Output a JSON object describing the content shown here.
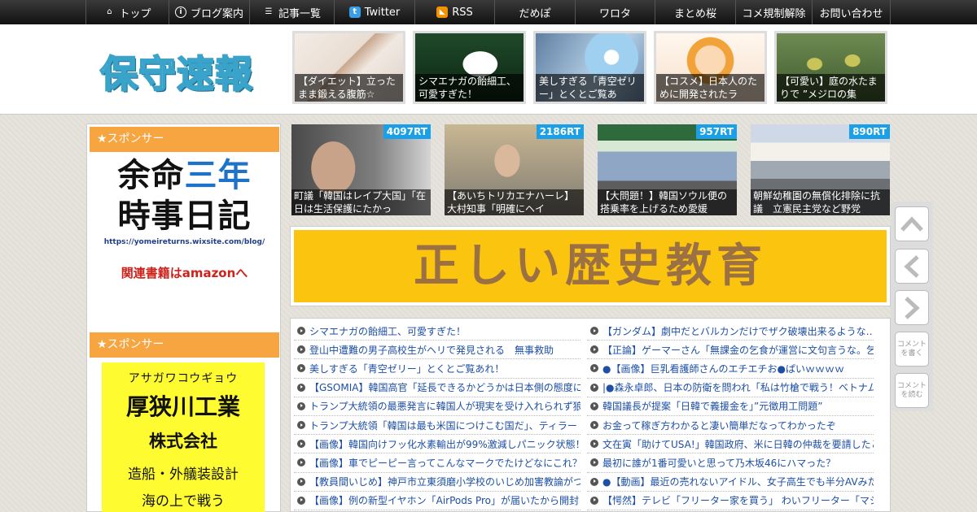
{
  "nav": {
    "items": [
      {
        "label": "トップ",
        "icon": "home-icon"
      },
      {
        "label": "ブログ案内",
        "icon": "info-icon"
      },
      {
        "label": "記事一覧",
        "icon": "list-icon"
      },
      {
        "label": "Twitter",
        "icon": "twitter-icon"
      },
      {
        "label": "RSS",
        "icon": "rss-icon"
      },
      {
        "label": "だめぽ"
      },
      {
        "label": "ワロタ"
      },
      {
        "label": "まとめ桜"
      },
      {
        "label": "コメ規制解除"
      },
      {
        "label": "お問い合わせ"
      }
    ]
  },
  "header": {
    "logo": "保守速報",
    "features": [
      {
        "caption": "【ダイエット】立ったまま鍛える腹筋☆"
      },
      {
        "caption": "シマエナガの飴細工、可愛すぎた！"
      },
      {
        "caption": "美しすぎる「青空ゼリー」とくとご覧あ"
      },
      {
        "caption": "【コスメ】日本人のために開発されたラ"
      },
      {
        "caption": "【可愛い】庭の水たまりで ”メジロの集"
      }
    ]
  },
  "sidebar": {
    "sponsor_label": "★スポンサー",
    "ad1": {
      "line1_a": "余命",
      "line1_b": "三年",
      "line2": "時事日記",
      "url": "https://yomeireturns.wixsite.com/blog/",
      "link": "関連書籍はamazonへ"
    },
    "ad2": {
      "kana": "アサガワコウギョウ",
      "name": "厚狭川工業",
      "corp": "株式会社",
      "desc1": "造船・外艤装設計",
      "desc2": "海の上で戦う"
    }
  },
  "trending": [
    {
      "rt": "4097RT",
      "caption": "町議「韓国はレイプ大国」「在日は生活保護にたかっ"
    },
    {
      "rt": "2186RT",
      "caption": "【あいちトリカエナハーレ】大村知事「明確にヘイ"
    },
    {
      "rt": "957RT",
      "caption": "【大問題！】韓国ソウル便の搭乗率を上げるため愛媛"
    },
    {
      "rt": "890RT",
      "caption": "朝鮮幼稚園の無償化排除に抗議　立憲民主党など野党"
    }
  ],
  "banner": {
    "text": "正しい歴史教育"
  },
  "articles_left": [
    "シマエナガの飴細工、可愛すぎた！",
    "登山中遭難の男子高校生がヘリで発見される　無事救助",
    "美しすぎる「青空ゼリー」とくとご覧あれ！",
    "【GSOMIA】韓国高官「延長できるかどうかは日本側の態度に",
    "トランプ大統領の最悪発言に韓国人が現実を受け入れられず狼",
    "トランプ大統領「韓国は最も米国につけこむ国だ」、ティラー",
    "【画像】韓国向けフッ化水素輸出が99%激減しパニック状態！",
    "【画像】車でピーピー言ってこんなマークでたけどなにこれ？",
    "【教員間いじめ】神戸市立東須磨小学校のいじめ加害教論がつ",
    "【画像】例の新型イヤホン「AirPods Pro」が届いたから開封し"
  ],
  "articles_right": [
    "【ガンダム】劇中だとバルカンだけでザク破壊出来るような…",
    "【正論】ゲーマーさん「無課金の乞食が運営に文句言うな。乞",
    "●【画像】巨乳看護師さんのエチエチお●ぱいｗｗｗｗ",
    "|●森永卓郎、日本の防衛を問われ「私は竹槍で戦う！ベトナム",
    "韓国議長が提案「日韓で義援金を」”元徴用工問題”",
    "お金って稼ぎ方わかると凄い簡単だなってわかったぞ",
    "文在寅「助けてUSA!」韓国政府、米に日韓の仲裁を要請したと",
    "最初に誰が1番可愛いと思って乃木坂46にハマった？",
    "●【動画】最近の売れないアイドル、女子高生でも半分AVみた",
    "【愕然】テレビ「フリーター家を買う」 わいフリーター「マシ"
  ],
  "side_buttons": {
    "comment_write": "コメントを書く",
    "comment_read": "コメントを読む"
  }
}
